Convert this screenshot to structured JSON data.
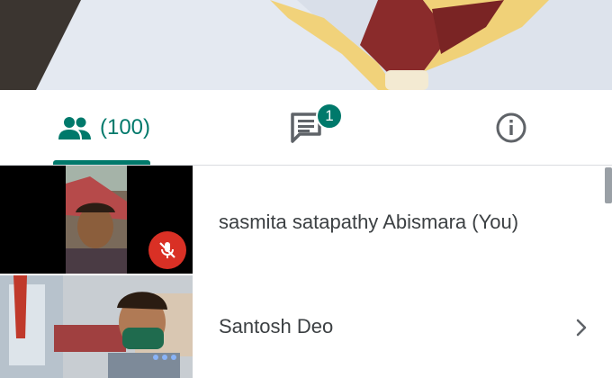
{
  "tabs": {
    "people_label": "(100)",
    "chat_badge": "1"
  },
  "participants": [
    {
      "name": "sasmita satapathy Abismara (You)",
      "muted": true
    },
    {
      "name": "Santosh Deo",
      "muted": false
    }
  ],
  "icons": {
    "people": "people-icon",
    "chat": "chat-icon",
    "info": "info-icon",
    "mic_off": "mic-off-icon",
    "chevron": "chevron-right-icon"
  },
  "colors": {
    "accent": "#00796b",
    "mute": "#d93025",
    "text": "#3c4043"
  }
}
